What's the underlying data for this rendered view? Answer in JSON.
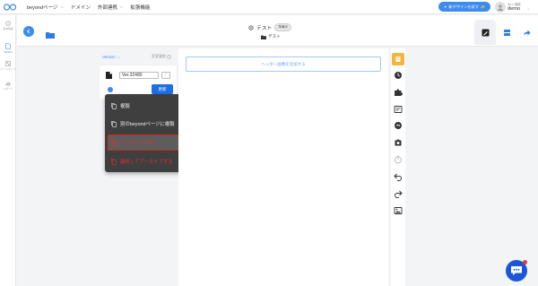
{
  "topnav": {
    "menu": [
      {
        "label": "beyondページ"
      },
      {
        "label": "ドメイン"
      },
      {
        "label": "外部連携"
      },
      {
        "label": "拡張機能"
      }
    ],
    "new_design_button": "新デザインを試す",
    "user_subtitle": "大川 瑞穂",
    "user_name": "demo"
  },
  "leftrail": {
    "items": [
      {
        "label": "基本情報",
        "icon": "info-icon"
      },
      {
        "label": "Version",
        "icon": "file-icon",
        "active": true
      },
      {
        "label": "ヒートマップ",
        "icon": "heatmap-icon"
      },
      {
        "label": "レポート",
        "icon": "chart-icon"
      }
    ]
  },
  "header": {
    "page_title": "テスト",
    "status_badge": "準備中",
    "folder_name": "テスト"
  },
  "version_panel": {
    "heading": "Version",
    "history_label": "変更履歴",
    "version_value": "Ver.32480",
    "more_label": "⋮",
    "update_button": "更新"
  },
  "context_menu": {
    "items": [
      {
        "label": "複製",
        "icon": "copy-icon",
        "style": "normal"
      },
      {
        "label": "別のbeyondページに複製",
        "icon": "copy-icon",
        "style": "normal"
      },
      {
        "label": "アーカイブする",
        "icon": "archive-icon",
        "style": "danger-highlight"
      },
      {
        "label": "最終してアーカイブする",
        "icon": "archive-icon",
        "style": "danger"
      }
    ]
  },
  "canvas": {
    "add_header_button": "ヘッダー画像を追加する"
  },
  "colors": {
    "accent": "#3e8bef",
    "danger": "#e0302a",
    "menu_bg": "#3f3f40",
    "active_tool": "#f6b43a"
  }
}
